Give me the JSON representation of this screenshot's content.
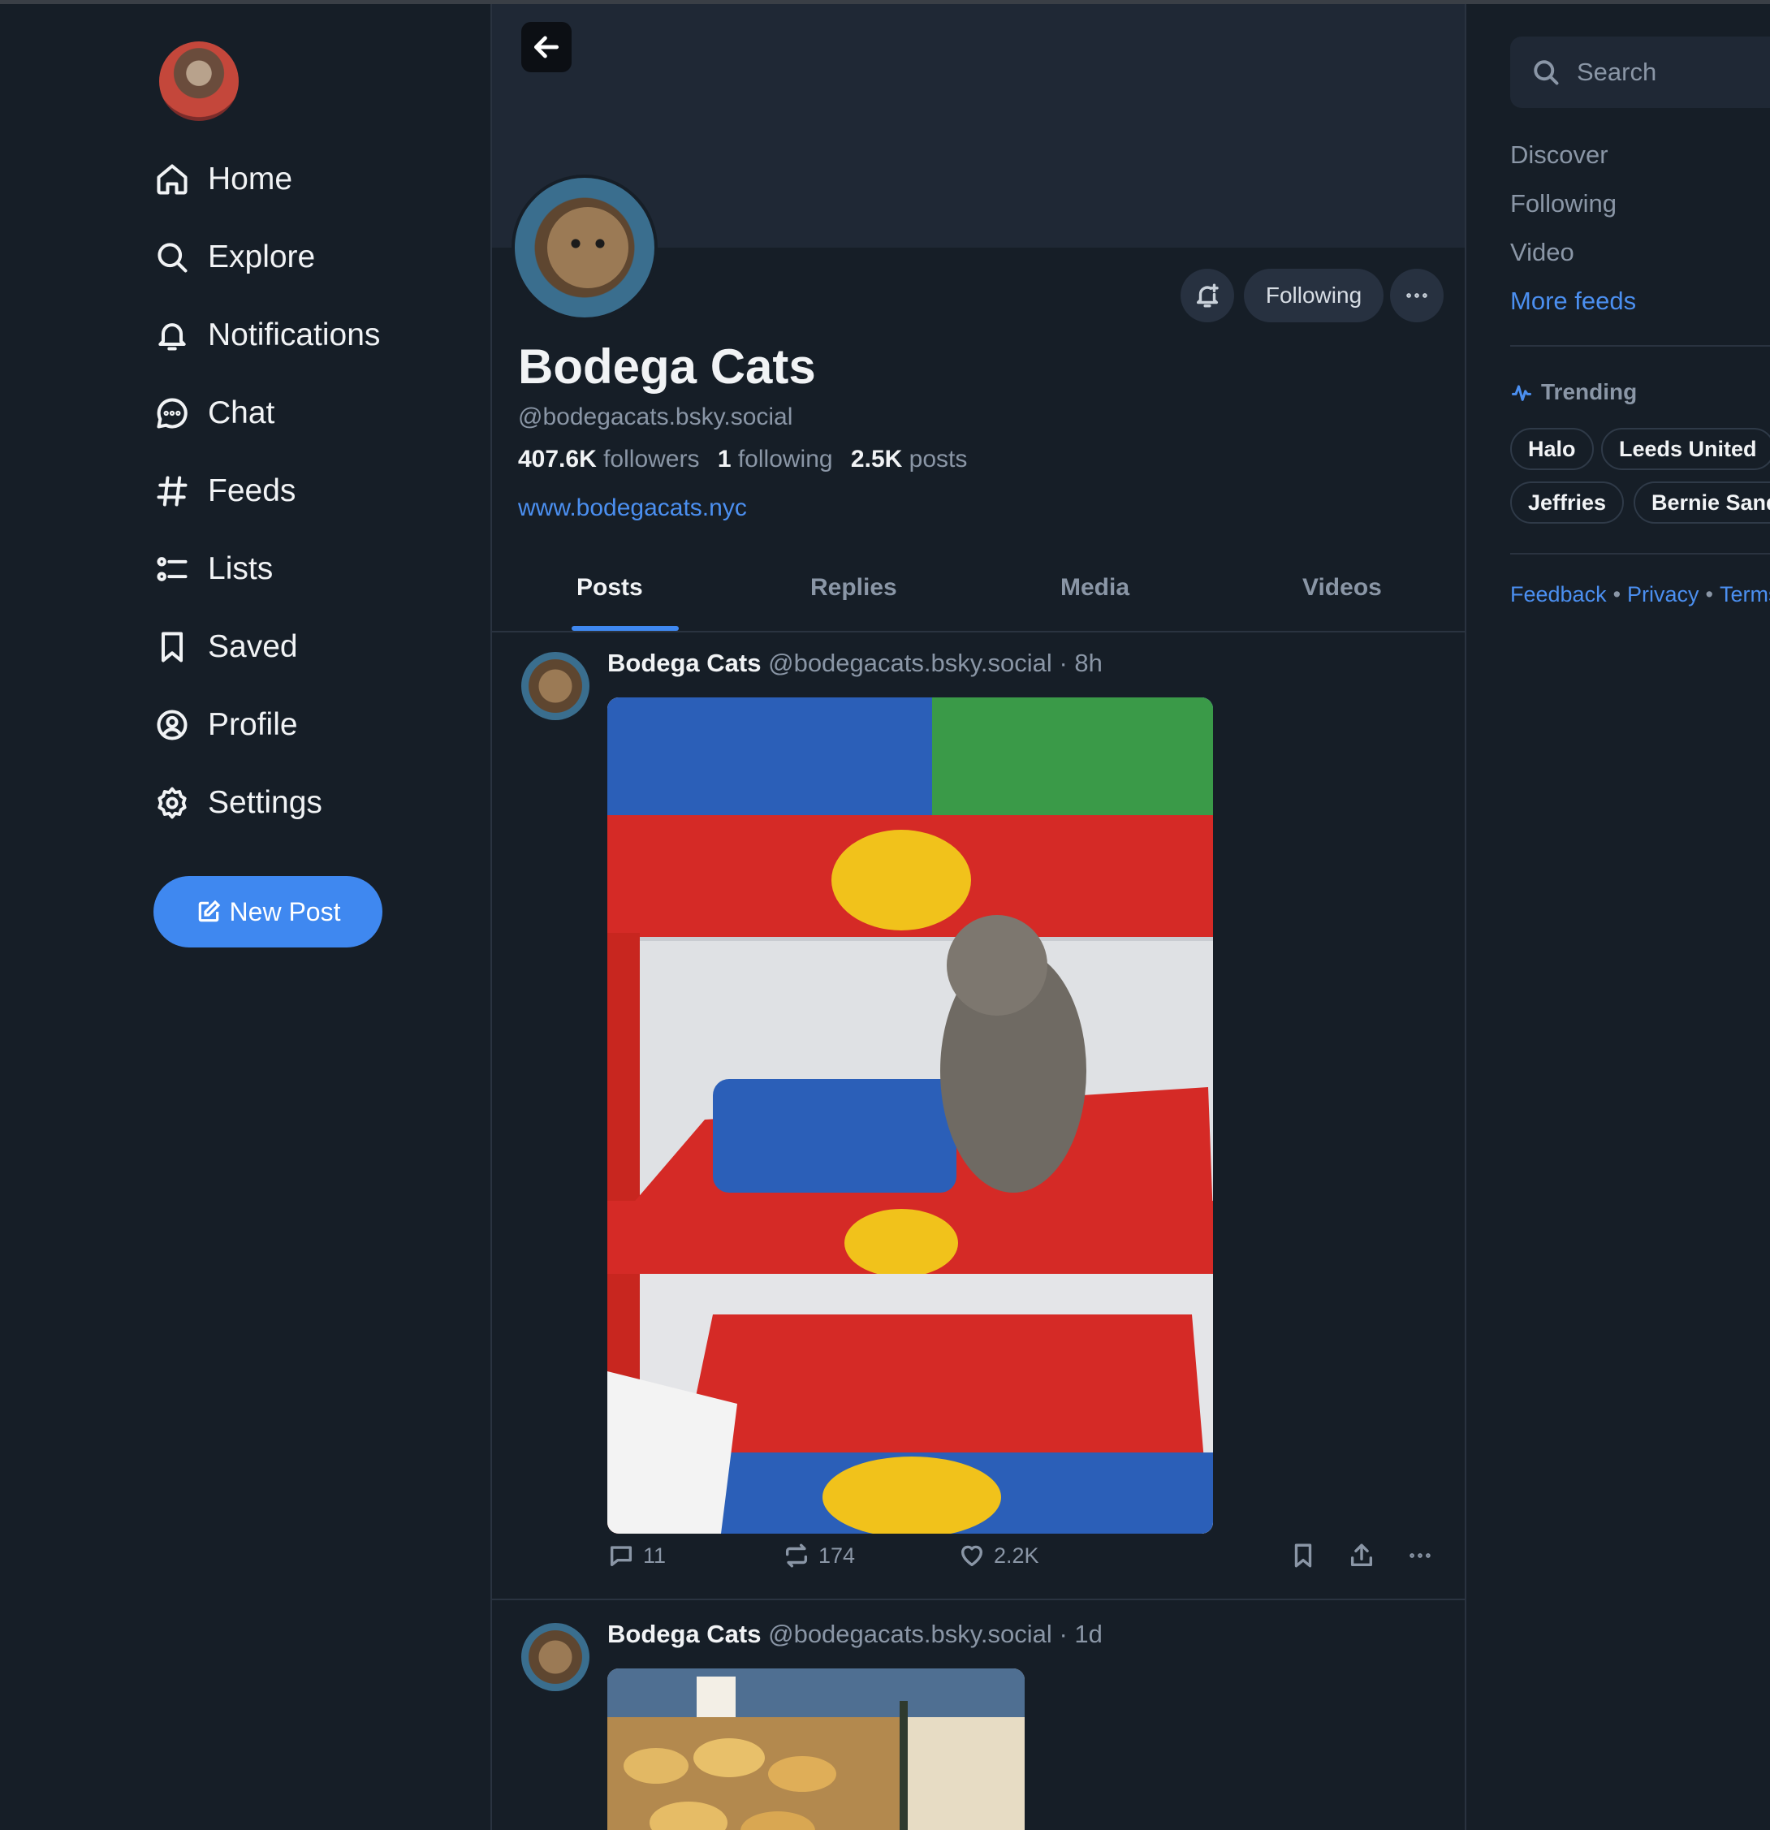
{
  "sidebar": {
    "items": [
      {
        "label": "Home",
        "icon": "home-icon"
      },
      {
        "label": "Explore",
        "icon": "search-icon"
      },
      {
        "label": "Notifications",
        "icon": "bell-icon"
      },
      {
        "label": "Chat",
        "icon": "chat-icon"
      },
      {
        "label": "Feeds",
        "icon": "hash-icon"
      },
      {
        "label": "Lists",
        "icon": "list-icon"
      },
      {
        "label": "Saved",
        "icon": "bookmark-icon"
      },
      {
        "label": "Profile",
        "icon": "user-circle-icon"
      },
      {
        "label": "Settings",
        "icon": "gear-icon"
      }
    ],
    "new_post_label": "New Post"
  },
  "profile": {
    "name": "Bodega Cats",
    "handle": "@bodegacats.bsky.social",
    "followers_count": "407.6K",
    "followers_label": "followers",
    "following_count": "1",
    "following_label": "following",
    "posts_count": "2.5K",
    "posts_label": "posts",
    "website": "www.bodegacats.nyc",
    "following_button": "Following"
  },
  "tabs": [
    "Posts",
    "Replies",
    "Media",
    "Videos"
  ],
  "active_tab": "Posts",
  "posts": [
    {
      "author": "Bodega Cats",
      "handle": "@bodegacats.bsky.social",
      "time": "· 8h",
      "replies": "11",
      "reposts": "174",
      "likes": "2.2K"
    },
    {
      "author": "Bodega Cats",
      "handle": "@bodegacats.bsky.social",
      "time": "· 1d"
    }
  ],
  "right": {
    "search_placeholder": "Search",
    "feeds": [
      "Discover",
      "Following",
      "Video"
    ],
    "more_feeds": "More feeds",
    "trending_title": "Trending",
    "trending": [
      "Halo",
      "Leeds United",
      "Jeffries",
      "Bernie Sanders"
    ],
    "footer": [
      "Feedback",
      "Privacy",
      "Terms"
    ]
  },
  "colors": {
    "accent": "#3f88f0",
    "background": "#161e27",
    "link": "#4b8ff0"
  }
}
